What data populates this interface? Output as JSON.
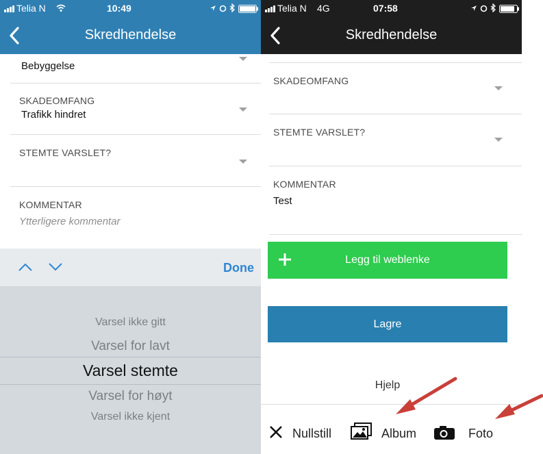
{
  "left": {
    "status": {
      "carrier": "Telia N",
      "time": "10:49"
    },
    "nav": {
      "title": "Skredhendelse"
    },
    "fields": {
      "top_value": "Bebyggelse",
      "skadeomfang_label": "SKADEOMFANG",
      "skadeomfang_value": "Trafikk hindret",
      "stemte_label": "STEMTE VARSLET?",
      "kommentar_label": "KOMMENTAR",
      "kommentar_placeholder": "Ytterligere kommentar"
    },
    "picker": {
      "done_label": "Done",
      "options": [
        "Varsel ikke gitt",
        "Varsel for lavt",
        "Varsel stemte",
        "Varsel for høyt",
        "Varsel ikke kjent"
      ],
      "selected": "Varsel stemte"
    }
  },
  "right": {
    "status": {
      "carrier": "Telia N",
      "network": "4G",
      "time": "07:58"
    },
    "nav": {
      "title": "Skredhendelse"
    },
    "fields": {
      "skadeomfang_label": "SKADEOMFANG",
      "stemte_label": "STEMTE VARSLET?",
      "kommentar_label": "KOMMENTAR",
      "kommentar_value": "Test"
    },
    "buttons": {
      "weblink": "Legg til weblenke",
      "save": "Lagre",
      "help": "Hjelp"
    },
    "bottom_bar": {
      "reset": "Nullstill",
      "album": "Album",
      "photo": "Foto"
    }
  },
  "colors": {
    "left_nav": "#2f7fb2",
    "right_nav": "#1e1e1e",
    "green_button": "#2ecc4f",
    "blue_button": "#2980b0",
    "annotation_arrow": "#c9403a"
  },
  "icons": [
    "signal-icon",
    "wifi-icon",
    "location-icon",
    "alarm-icon",
    "bluetooth-icon",
    "battery-icon",
    "back-chevron-icon",
    "caret-down-icon",
    "chevron-up-icon",
    "chevron-down-icon",
    "plus-icon",
    "close-x-icon",
    "album-icon",
    "camera-icon",
    "red-arrow-icon"
  ]
}
